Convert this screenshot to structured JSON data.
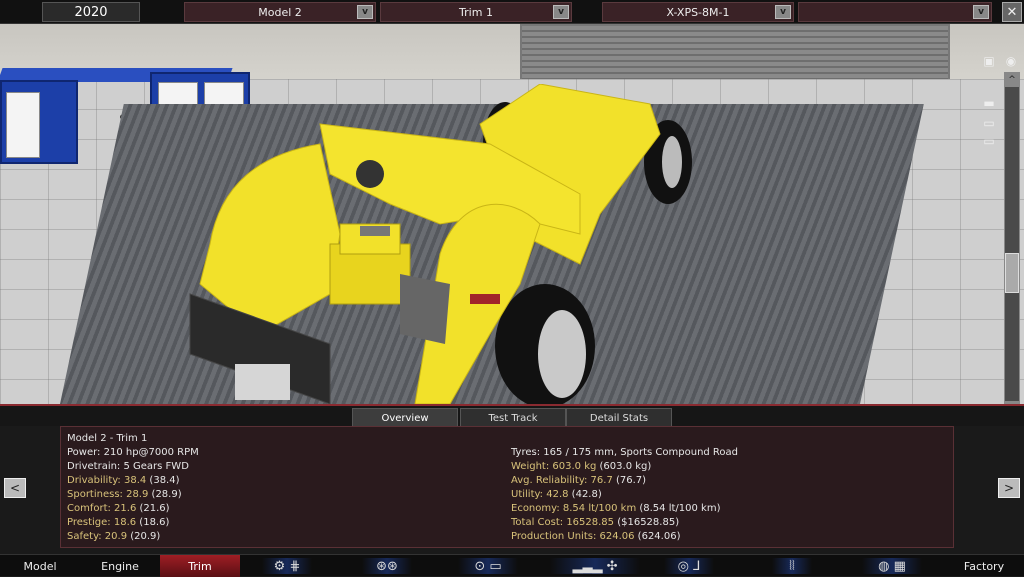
{
  "top": {
    "year": "2020",
    "model": "Model 2",
    "trim": "Trim 1",
    "engine": "X-XPS-8M-1",
    "extra": "",
    "dropdown_glyph": "v",
    "close": "✕"
  },
  "side_icons": [
    "camera-icon",
    "eye-icon",
    "car-side-icon",
    "car-front-icon",
    "car-rear-icon",
    "car-top-icon"
  ],
  "tabs": [
    {
      "label": "Overview",
      "active": true
    },
    {
      "label": "Test Track",
      "active": false
    },
    {
      "label": "Detail Stats",
      "active": false
    }
  ],
  "stats": {
    "title": "Model 2 - Trim 1",
    "power": "Power: 210 hp@7000 RPM",
    "drivetrain": "Drivetrain: 5 Gears FWD",
    "drivability_k": "Drivability: 38.4",
    "drivability_v": " (38.4)",
    "sportiness_k": "Sportiness: 28.9",
    "sportiness_v": " (28.9)",
    "comfort_k": "Comfort: 21.6",
    "comfort_v": " (21.6)",
    "prestige_k": "Prestige: 18.6",
    "prestige_v": " (18.6)",
    "safety_k": "Safety: 20.9",
    "safety_v": " (20.9)",
    "tyres": "Tyres: 165 / 175 mm, Sports Compound Road",
    "weight_k": "Weight: 603.0 kg",
    "weight_v": " (603.0 kg)",
    "reliability_k": "Avg. Reliability: 76.7",
    "reliability_v": " (76.7)",
    "utility_k": "Utility: 42.8",
    "utility_v": " (42.8)",
    "economy_k": "Economy: 8.54 lt/100 km",
    "economy_v": " (8.54 lt/100 km)",
    "cost_k": "Total Cost: 16528.85",
    "cost_v": " ($16528.85)",
    "units_k": "Production Units: 624.06",
    "units_v": " (624.06)"
  },
  "nav": {
    "prev": "<",
    "next": ">"
  },
  "bottom": {
    "model": "Model",
    "engine": "Engine",
    "trim": "Trim",
    "factory": "Factory"
  },
  "colors": {
    "accent": "#9e1e24",
    "car": "#f2e12a",
    "stat_key": "#d8c27a"
  }
}
